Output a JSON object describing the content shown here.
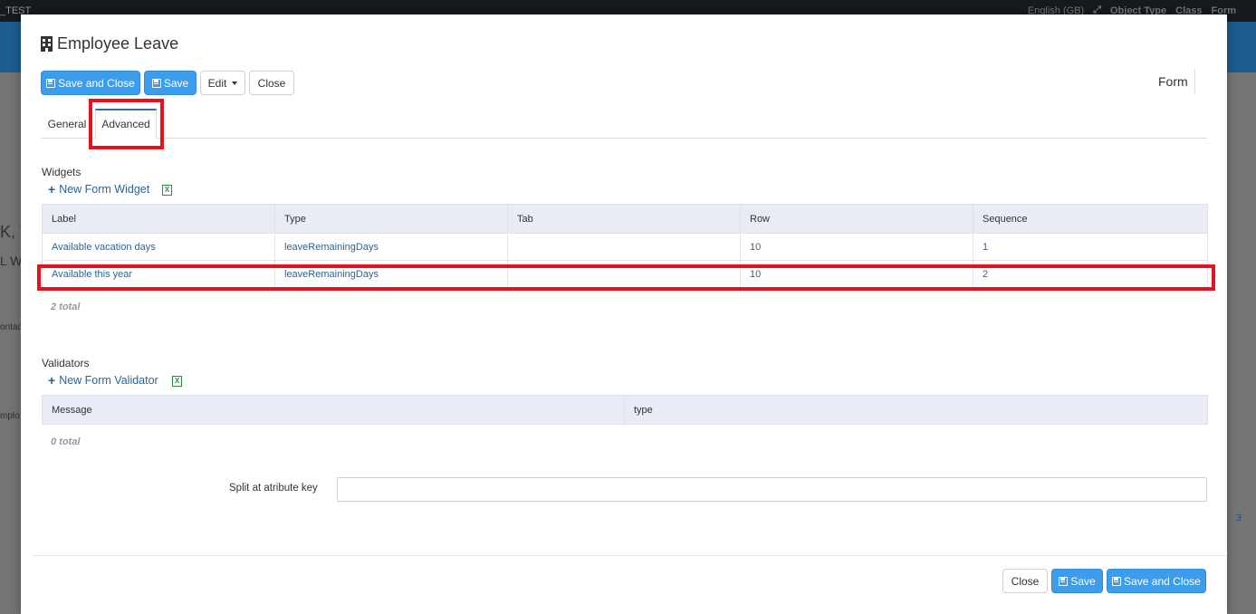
{
  "background": {
    "app_name": "_TEST",
    "language": "English (GB)",
    "menu": [
      "Object Type",
      "Class",
      "Form"
    ],
    "left_fragments": [
      "K, T",
      "L W",
      "ontac",
      "mplo"
    ],
    "right_fragment": "3"
  },
  "modal": {
    "title": "Employee Leave",
    "title_icon": "building-icon",
    "form_label": "Form"
  },
  "toolbar": {
    "save_and_close_label": "Save and Close",
    "save_label": "Save",
    "edit_label": "Edit",
    "close_label": "Close"
  },
  "tabs": [
    {
      "label": "General",
      "active": false
    },
    {
      "label": "Advanced",
      "active": true
    }
  ],
  "widgets": {
    "section_label": "Widgets",
    "new_label": "New Form Widget",
    "columns": [
      "Label",
      "Type",
      "Tab",
      "Row",
      "Sequence"
    ],
    "rows": [
      {
        "label": "Available vacation days",
        "type": "leaveRemainingDays",
        "tab": "",
        "row": "10",
        "sequence": "1"
      },
      {
        "label": "Available this year",
        "type": "leaveRemainingDays",
        "tab": "",
        "row": "10",
        "sequence": "2"
      }
    ],
    "total": "2 total"
  },
  "validators": {
    "section_label": "Validators",
    "new_label": "New Form Validator",
    "columns": [
      "Message",
      "type"
    ],
    "total": "0 total"
  },
  "split": {
    "label": "Split at atribute key",
    "value": ""
  },
  "footer": {
    "close_label": "Close",
    "save_label": "Save",
    "save_and_close_label": "Save and Close"
  },
  "colors": {
    "primary": "#3c9ded",
    "highlight": "#e3121f",
    "link": "#2a6496"
  }
}
